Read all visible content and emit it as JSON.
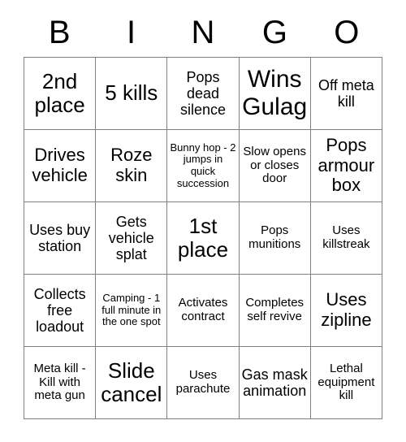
{
  "card": {
    "header_letters": [
      "B",
      "I",
      "N",
      "G",
      "O"
    ],
    "rows": [
      [
        {
          "text": "2nd place",
          "size": "fs-lg"
        },
        {
          "text": "5 kills",
          "size": "fs-lg"
        },
        {
          "text": "Pops dead silence",
          "size": "fs-sm"
        },
        {
          "text": "Wins Gulag",
          "size": "fs-xl"
        },
        {
          "text": "Off meta kill",
          "size": "fs-sm"
        }
      ],
      [
        {
          "text": "Drives vehicle",
          "size": "fs-md"
        },
        {
          "text": "Roze skin",
          "size": "fs-md"
        },
        {
          "text": "Bunny hop - 2 jumps in quick succession",
          "size": "fs-xxs"
        },
        {
          "text": "Slow opens or closes door",
          "size": "fs-xs"
        },
        {
          "text": "Pops armour box",
          "size": "fs-md"
        }
      ],
      [
        {
          "text": "Uses buy station",
          "size": "fs-sm"
        },
        {
          "text": "Gets vehicle splat",
          "size": "fs-sm"
        },
        {
          "text": "1st place",
          "size": "fs-lg"
        },
        {
          "text": "Pops munitions",
          "size": "fs-xs"
        },
        {
          "text": "Uses killstreak",
          "size": "fs-xs"
        }
      ],
      [
        {
          "text": "Collects free loadout",
          "size": "fs-sm"
        },
        {
          "text": "Camping - 1 full minute in the one spot",
          "size": "fs-xxs"
        },
        {
          "text": "Activates contract",
          "size": "fs-xs"
        },
        {
          "text": "Completes self revive",
          "size": "fs-xs"
        },
        {
          "text": "Uses zipline",
          "size": "fs-md"
        }
      ],
      [
        {
          "text": "Meta kill - Kill with meta gun",
          "size": "fs-xs"
        },
        {
          "text": "Slide cancel",
          "size": "fs-lg"
        },
        {
          "text": "Uses parachute",
          "size": "fs-xs"
        },
        {
          "text": "Gas mask animation",
          "size": "fs-sm"
        },
        {
          "text": "Lethal equipment kill",
          "size": "fs-xs"
        }
      ]
    ]
  },
  "colors": {
    "background": "#ffffff",
    "text": "#000000",
    "border": "#808080"
  }
}
